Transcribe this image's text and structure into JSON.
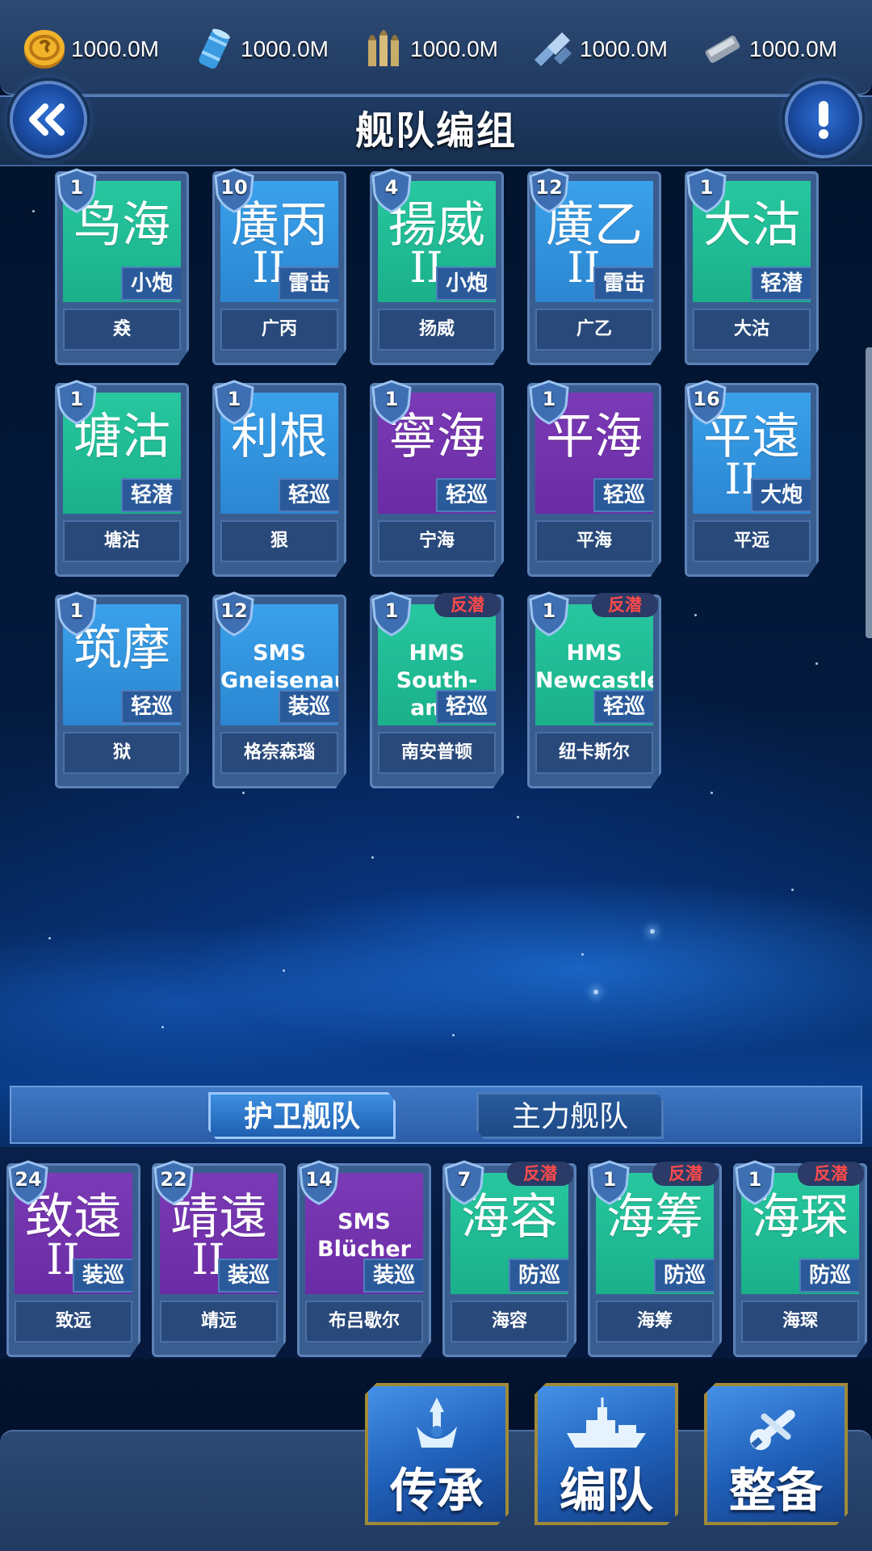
{
  "resources": [
    {
      "icon": "gold-coin-icon",
      "value": "1000.0M"
    },
    {
      "icon": "oil-barrel-icon",
      "value": "1000.0M"
    },
    {
      "icon": "ammo-shells-icon",
      "value": "1000.0M"
    },
    {
      "icon": "steel-icon",
      "value": "1000.0M"
    },
    {
      "icon": "aluminum-ingot-icon",
      "value": "1000.0M"
    }
  ],
  "header": {
    "title": "舰队编组",
    "back_icon": "double-chevron-left-icon",
    "info_icon": "exclamation-icon"
  },
  "roster": [
    {
      "level": "1",
      "big": "鸟海",
      "roman": "",
      "latin": "",
      "type": "小炮",
      "name": "猋",
      "color": "green",
      "asw": ""
    },
    {
      "level": "10",
      "big": "廣丙",
      "roman": "II",
      "latin": "",
      "type": "雷击",
      "name": "广丙",
      "color": "blue",
      "asw": ""
    },
    {
      "level": "4",
      "big": "揚威",
      "roman": "II",
      "latin": "",
      "type": "小炮",
      "name": "扬威",
      "color": "green",
      "asw": ""
    },
    {
      "level": "12",
      "big": "廣乙",
      "roman": "II",
      "latin": "",
      "type": "雷击",
      "name": "广乙",
      "color": "blue",
      "asw": ""
    },
    {
      "level": "1",
      "big": "大沽",
      "roman": "",
      "latin": "",
      "type": "轻潜",
      "name": "大沽",
      "color": "green",
      "asw": ""
    },
    {
      "level": "1",
      "big": "塘沽",
      "roman": "",
      "latin": "",
      "type": "轻潜",
      "name": "塘沽",
      "color": "green",
      "asw": ""
    },
    {
      "level": "1",
      "big": "利根",
      "roman": "",
      "latin": "",
      "type": "轻巡",
      "name": "狠",
      "color": "blue",
      "asw": ""
    },
    {
      "level": "1",
      "big": "寧海",
      "roman": "",
      "latin": "",
      "type": "轻巡",
      "name": "宁海",
      "color": "purple",
      "asw": ""
    },
    {
      "level": "1",
      "big": "平海",
      "roman": "",
      "latin": "",
      "type": "轻巡",
      "name": "平海",
      "color": "purple",
      "asw": ""
    },
    {
      "level": "16",
      "big": "平遠",
      "roman": "II",
      "latin": "",
      "type": "大炮",
      "name": "平远",
      "color": "blue",
      "asw": ""
    },
    {
      "level": "1",
      "big": "筑摩",
      "roman": "",
      "latin": "",
      "type": "轻巡",
      "name": "狱",
      "color": "blue",
      "asw": ""
    },
    {
      "level": "12",
      "big": "",
      "roman": "",
      "latin": "SMS Gneisenau",
      "type": "装巡",
      "name": "格奈森瑙",
      "color": "blue",
      "asw": ""
    },
    {
      "level": "1",
      "big": "",
      "roman": "",
      "latin": "HMS South-amp",
      "type": "轻巡",
      "name": "南安普顿",
      "color": "green",
      "asw": "反潜"
    },
    {
      "level": "1",
      "big": "",
      "roman": "",
      "latin": "HMS Newcastle",
      "type": "轻巡",
      "name": "纽卡斯尔",
      "color": "green",
      "asw": "反潜"
    }
  ],
  "tabs": {
    "escort": "护卫舰队",
    "main": "主力舰队"
  },
  "fleet": [
    {
      "level": "24",
      "big": "致遠",
      "roman": "II",
      "latin": "",
      "type": "装巡",
      "name": "致远",
      "color": "purple",
      "asw": ""
    },
    {
      "level": "22",
      "big": "靖遠",
      "roman": "II",
      "latin": "",
      "type": "装巡",
      "name": "靖远",
      "color": "purple",
      "asw": ""
    },
    {
      "level": "14",
      "big": "",
      "roman": "",
      "latin": "SMS Blücher",
      "type": "装巡",
      "name": "布吕歇尔",
      "color": "purple",
      "asw": ""
    },
    {
      "level": "7",
      "big": "海容",
      "roman": "",
      "latin": "",
      "type": "防巡",
      "name": "海容",
      "color": "green",
      "asw": "反潜"
    },
    {
      "level": "1",
      "big": "海筹",
      "roman": "",
      "latin": "",
      "type": "防巡",
      "name": "海筹",
      "color": "green",
      "asw": "反潜"
    },
    {
      "level": "1",
      "big": "海琛",
      "roman": "",
      "latin": "",
      "type": "防巡",
      "name": "海琛",
      "color": "green",
      "asw": "反潜"
    }
  ],
  "actions": [
    {
      "label": "传承",
      "icon": "inheritance-icon"
    },
    {
      "label": "编队",
      "icon": "fleet-ship-icon"
    },
    {
      "label": "整备",
      "icon": "wrench-icon"
    }
  ]
}
